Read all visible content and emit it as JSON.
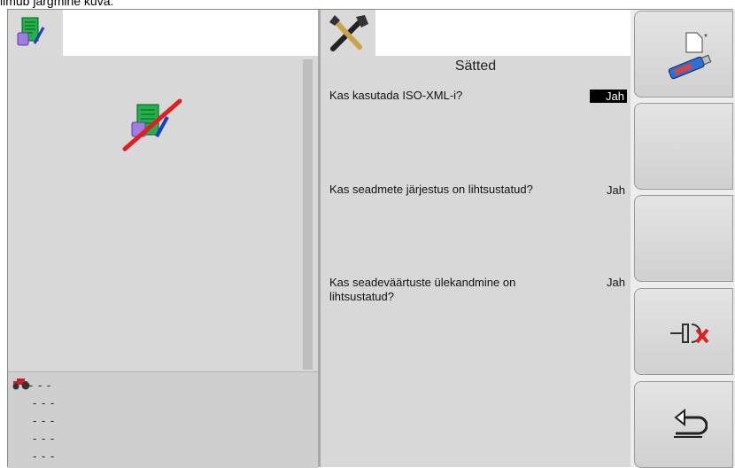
{
  "caption": "ilmub järgmine kuva:",
  "left_pane": {
    "tab_icon": "task-document-icon",
    "main_icon": "task-document-disabled-icon",
    "status_icon": "tractor-icon",
    "status_lines": [
      "- - -",
      "- - -",
      "- - -",
      "- - -",
      "- - -"
    ]
  },
  "settings": {
    "tab_icon": "tools-icon",
    "title": "Sätted",
    "items": [
      {
        "question": "Kas kasutada ISO-XML-i?",
        "value": "Jah"
      },
      {
        "question": "Kas seadmete järjestus on lihtsustatud?",
        "value": "Jah"
      },
      {
        "question": "Kas seadeväärtuste ülekandmine on lihtsustatud?",
        "value": "Jah"
      }
    ]
  },
  "right_buttons": [
    {
      "name": "new-usb-button",
      "icon": "usb-new-icon"
    },
    {
      "name": "empty-button-2",
      "icon": ""
    },
    {
      "name": "empty-button-3",
      "icon": ""
    },
    {
      "name": "disconnect-button",
      "icon": "disconnect-icon"
    },
    {
      "name": "back-button",
      "icon": "back-arrow-icon"
    }
  ],
  "colors": {
    "highlight": "#000000",
    "green": "#22b14c",
    "red": "#e02020"
  }
}
